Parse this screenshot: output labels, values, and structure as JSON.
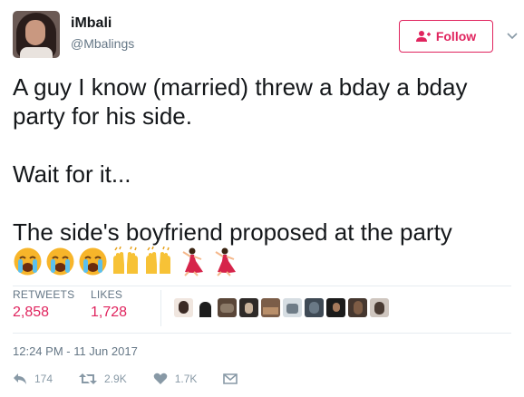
{
  "user": {
    "name": "iMbali",
    "handle": "@Mbalings"
  },
  "follow_label": "Follow",
  "colors": {
    "accent": "#e0245e",
    "text": "#14171a",
    "muted": "#657786",
    "icon": "#8899a6"
  },
  "tweet": {
    "lines": [
      "A guy I know (married) threw a bday a bday party for his side.",
      "Wait for it...",
      "The side's boyfriend proposed at the party"
    ],
    "emojis": [
      "crying-face",
      "crying-face",
      "crying-face",
      "raised-hands",
      "raised-hands",
      "dancer",
      "dancer"
    ]
  },
  "stats": {
    "retweets_label": "RETWEETS",
    "retweets_value": "2,858",
    "likes_label": "LIKES",
    "likes_value": "1,728",
    "liker_avatar_count": 10
  },
  "timestamp": "12:24 PM - 11 Jun 2017",
  "actions": {
    "reply": "174",
    "retweet": "2.9K",
    "like": "1.7K",
    "dm_icon": "envelope-icon"
  }
}
